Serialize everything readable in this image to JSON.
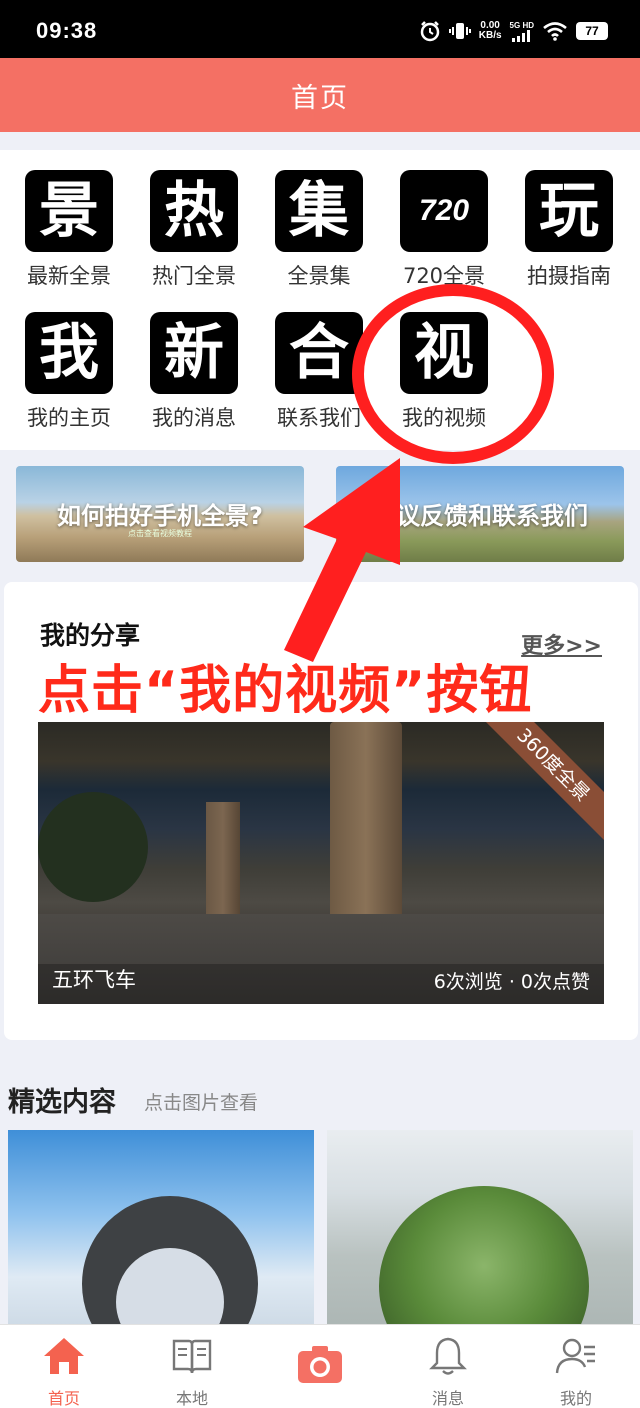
{
  "status_bar": {
    "time": "09:38",
    "net_speed": "0.00",
    "net_unit": "KB/s",
    "signal_label": "5G HD",
    "battery": "77"
  },
  "header": {
    "title": "首页"
  },
  "grid": [
    {
      "glyph": "景",
      "label": "最新全景",
      "icon": "jing-icon"
    },
    {
      "glyph": "热",
      "label": "热门全景",
      "icon": "re-icon"
    },
    {
      "glyph": "集",
      "label": "全景集",
      "icon": "ji-icon"
    },
    {
      "glyph": "720",
      "label": "720全景",
      "icon": "720-icon"
    },
    {
      "glyph": "玩",
      "label": "拍摄指南",
      "icon": "wan-icon"
    },
    {
      "glyph": "我",
      "label": "我的主页",
      "icon": "wo-icon"
    },
    {
      "glyph": "新",
      "label": "我的消息",
      "icon": "xin-icon"
    },
    {
      "glyph": "合",
      "label": "联系我们",
      "icon": "he-icon"
    },
    {
      "glyph": "视",
      "label": "我的视频",
      "icon": "shi-icon"
    }
  ],
  "banners": {
    "left": {
      "text": "如何拍好手机全景?",
      "subtext": "点击查看视频教程"
    },
    "right": {
      "text": "建议反馈和联系我们"
    }
  },
  "share": {
    "title": "我的分享",
    "more": "更多>>",
    "item": {
      "name": "五环飞车",
      "stats": "6次浏览 · 0次点赞",
      "badge": "360度全景"
    }
  },
  "annotation": {
    "text": "点击“我的视频”按钮"
  },
  "featured": {
    "title": "精选内容",
    "subtitle": "点击图片查看"
  },
  "bottom_nav": [
    {
      "label": "首页",
      "icon": "home-icon",
      "active": true
    },
    {
      "label": "本地",
      "icon": "book-icon",
      "active": false
    },
    {
      "label": "",
      "icon": "camera-icon",
      "active": false
    },
    {
      "label": "消息",
      "icon": "bell-icon",
      "active": false
    },
    {
      "label": "我的",
      "icon": "profile-icon",
      "active": false
    }
  ],
  "colors": {
    "accent": "#f47064",
    "annotation": "#ff1f1f",
    "active_nav": "#f4624f"
  }
}
